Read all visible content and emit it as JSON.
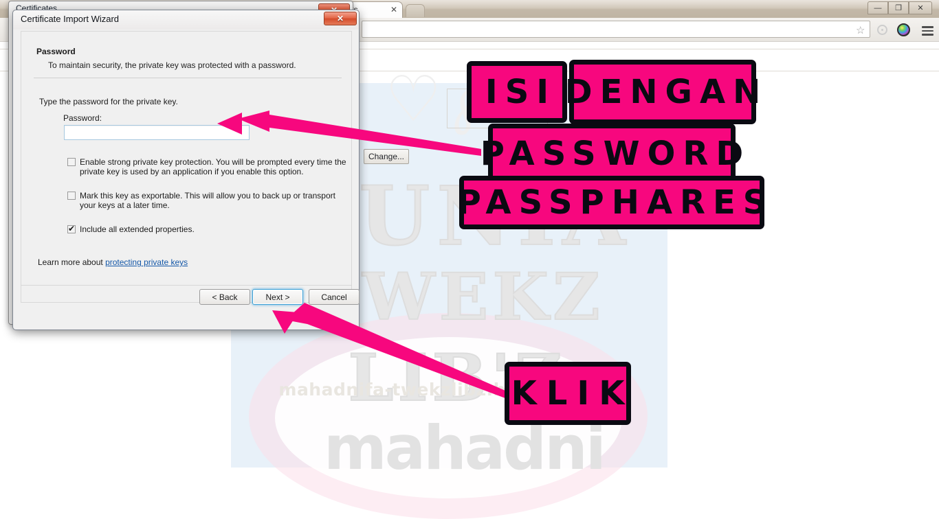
{
  "browser": {
    "tab": {
      "label": "sults",
      "close_icon": "close-icon"
    },
    "new_tab_icon": "new-tab-icon",
    "window_controls": {
      "minimize": "—",
      "maximize": "❐",
      "close": "✕"
    },
    "address_bar_value": "",
    "toolbar_icons": [
      "star-icon",
      "circle-icon",
      "color-ball-icon",
      "hamburger-menu-icon"
    ],
    "page_buttons": {
      "change": "Change..."
    }
  },
  "watermarks": {
    "big_line1": "DUNIA",
    "big_line2": "TWEKZ LIB'Z",
    "url": "mahadnifa-twekzlibz.blogspot.com",
    "brand": "mahadni"
  },
  "cert_window": {
    "title": "Certificates",
    "close_label": "✕"
  },
  "wizard": {
    "title": "Certificate Import Wizard",
    "close_label": "✕",
    "header": {
      "title": "Password",
      "subtitle": "To maintain security, the private key was protected with a password."
    },
    "instruction": "Type the password for the private key.",
    "password": {
      "label": "Password:",
      "value": "",
      "placeholder": ""
    },
    "checkboxes": [
      {
        "label": "Enable strong private key protection. You will be prompted every time the private key is used by an application if you enable this option.",
        "checked": false
      },
      {
        "label": "Mark this key as exportable. This will allow you to back up or transport your keys at a later time.",
        "checked": false
      },
      {
        "label": "Include all extended properties.",
        "checked": true
      }
    ],
    "learn_more_prefix": "Learn more about ",
    "learn_more_link": "protecting private keys",
    "buttons": {
      "back": "< Back",
      "next": "Next >",
      "cancel": "Cancel"
    }
  },
  "annotations": {
    "colors": {
      "pink": "#f7077e",
      "outline": "#0a0a12"
    },
    "boxes": [
      {
        "text": "ISI"
      },
      {
        "text": "DENGAN"
      },
      {
        "text": "PASSWORD"
      },
      {
        "text": "PASSPHARES"
      },
      {
        "text": "KLIK"
      }
    ]
  }
}
